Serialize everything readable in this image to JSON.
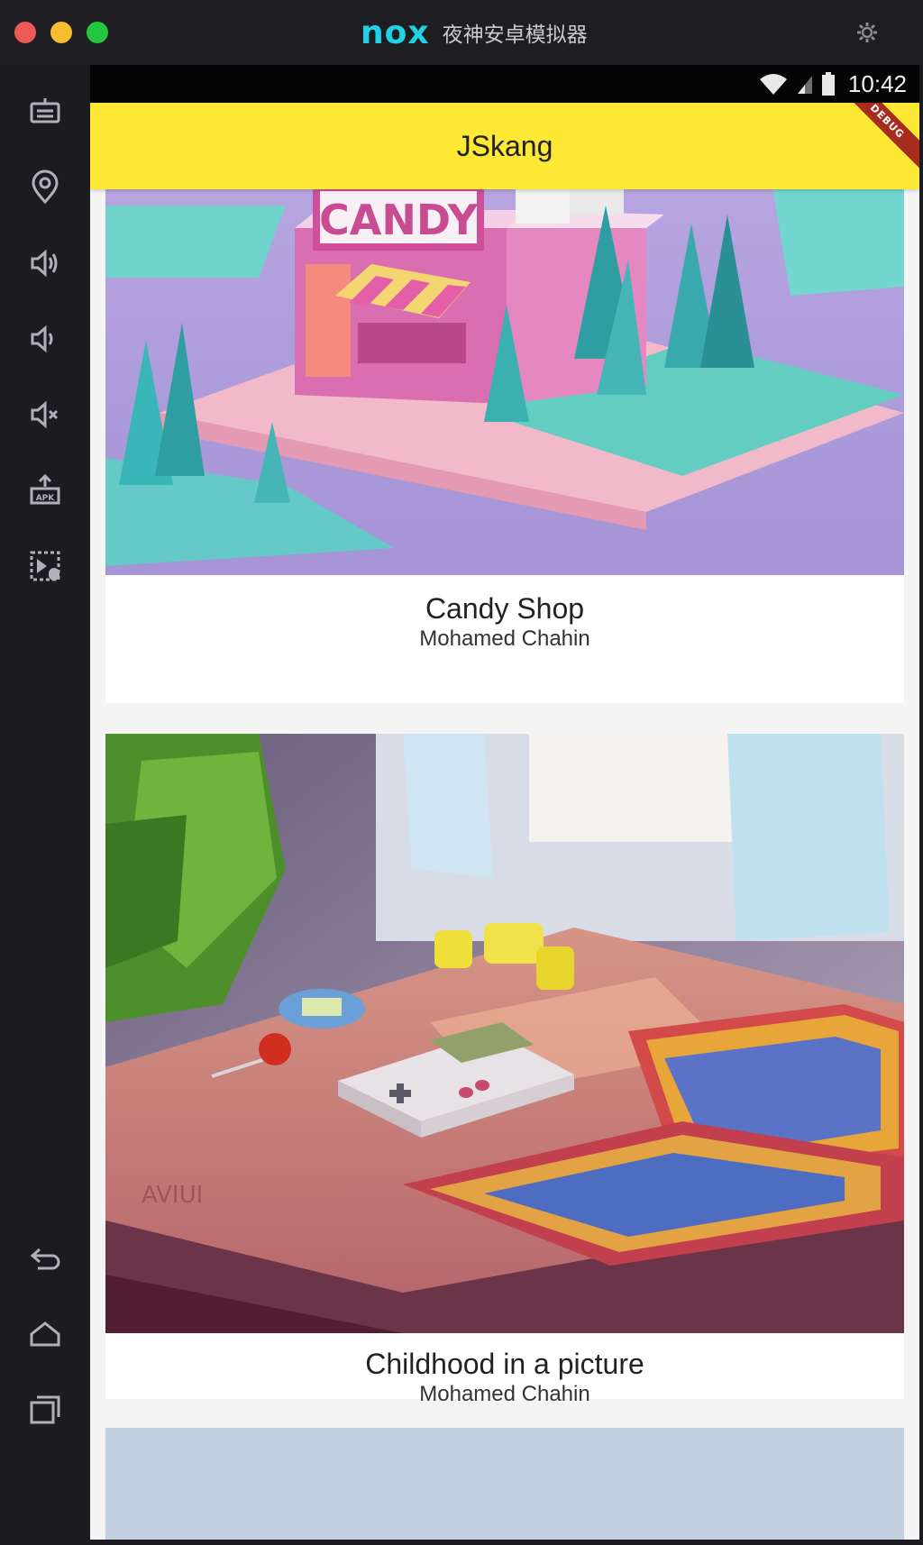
{
  "window": {
    "logo_text": "nox",
    "app_name": "夜神安卓模拟器"
  },
  "status_bar": {
    "time": "10:42"
  },
  "app_bar": {
    "title": "JSkang",
    "debug_label": "DEBUG"
  },
  "cards": [
    {
      "title": "Candy Shop",
      "author": "Mohamed Chahin",
      "sign_text": "CANDY"
    },
    {
      "title": "Childhood in a picture",
      "author": "Mohamed Chahin",
      "desk_text": "AVIUI"
    }
  ],
  "sidebar_tools": [
    "keyboard-icon",
    "location-icon",
    "volume-up-icon",
    "volume-down-icon",
    "mute-icon",
    "apk-install-icon",
    "screen-record-icon",
    "back-icon",
    "home-icon",
    "recents-icon"
  ],
  "colors": {
    "app_bar": "#fde935",
    "traffic_red": "#ee5b55",
    "traffic_yellow": "#f5bd2f",
    "traffic_green": "#24c73f",
    "brand": "#1fd2e6"
  }
}
